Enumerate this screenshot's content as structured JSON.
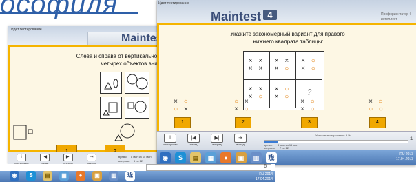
{
  "slide_title": "ософиля",
  "back_window": {
    "header_label": "Идет тестирование",
    "logo": "Maintes",
    "question": "Слева и справа от вертикальной черты размещен\n             четырех объектов внизу тот, который с",
    "answers": [
      "1",
      "2"
    ],
    "toolbar": {
      "instructions": "инструкции",
      "back": "назад",
      "forward": "вперед",
      "exit": "выход",
      "time_label": "время:",
      "time_value": "8 мин из 15 мин",
      "questions_label": "вопросы:",
      "questions_value": "5 из 12"
    },
    "taskbar_tray": "RU",
    "taskbar_time": "2014"
  },
  "front_window": {
    "header_label": "Идет тестирование",
    "logo": "Maintest",
    "logo_num": "4",
    "prof_label": "Профориентатор 4",
    "prof_sub": "интеллект",
    "question": "Укажите закономерный вариант для правого\n нижнего квадрата таблицы:",
    "grid": [
      [
        [
          "× ×",
          "× ×"
        ],
        [
          "× ×",
          "× ○"
        ],
        [
          "× ○",
          "× ○"
        ]
      ],
      [
        [
          "× ×",
          "× ○"
        ],
        [
          "× ○",
          "× ○"
        ],
        [
          "?"
        ]
      ]
    ],
    "answer_options": [
      {
        "num": "1",
        "rows": [
          "× ○",
          "○ ×"
        ]
      },
      {
        "num": "2",
        "rows": [
          "○ ×",
          "× ○"
        ]
      },
      {
        "num": "3",
        "rows": [
          "× ○",
          "× ○"
        ]
      },
      {
        "num": "4",
        "rows": [
          "× ○",
          "○ ○"
        ]
      }
    ],
    "toolbar": {
      "instructions": "инструкции",
      "back": "назад",
      "forward": "вперед",
      "exit": "выход",
      "progress_label": "Участие тестирования: 9 %",
      "time_label": "время:",
      "time_value": "8 мин из 15 мин",
      "questions_label": "вопросы:",
      "questions_value": "7 из 12",
      "progress_num": "1",
      "progress": 0.09
    },
    "taskbar": {
      "lang": "RU",
      "time": "2013",
      "date": "17.04.2013"
    }
  },
  "bottom_strip": {
    "value": "6",
    "lang": "RU",
    "time": "2014",
    "date": "17.04.2014"
  }
}
